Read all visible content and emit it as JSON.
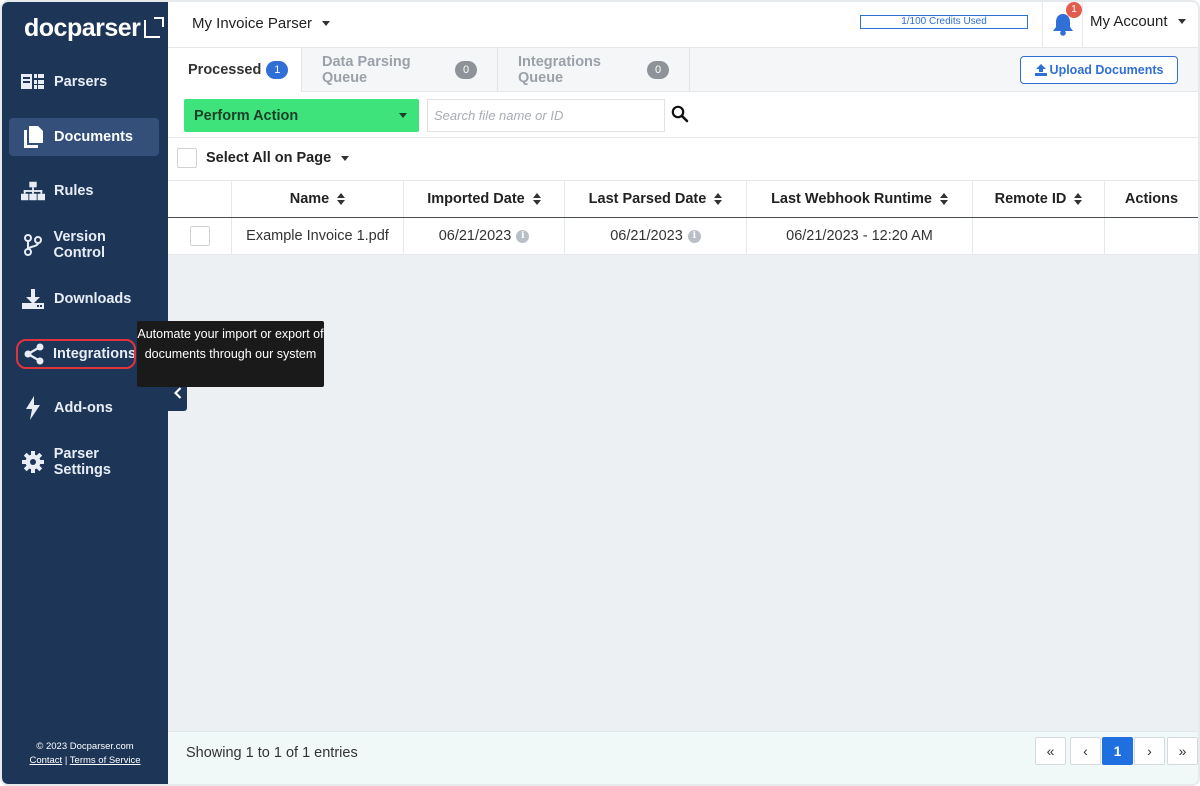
{
  "app": {
    "logo_text": "docparser"
  },
  "sidebar": {
    "items": [
      {
        "label": "Parsers",
        "icon": "parsers-icon"
      },
      {
        "label": "Documents",
        "icon": "documents-icon"
      },
      {
        "label": "Rules",
        "icon": "rules-icon"
      },
      {
        "label": "Version Control",
        "icon": "version-control-icon"
      },
      {
        "label": "Downloads",
        "icon": "downloads-icon"
      },
      {
        "label": "Integrations",
        "icon": "share-icon"
      },
      {
        "label": "Add-ons",
        "icon": "bolt-icon"
      },
      {
        "label": "Parser Settings",
        "icon": "gear-icon"
      }
    ],
    "active_item": "Documents",
    "highlighted_item": "Integrations",
    "footer": {
      "copyright": "© 2023 Docparser.com",
      "contact": "Contact",
      "separator": "|",
      "terms": "Terms of Service"
    }
  },
  "tooltip": {
    "text": "Automate your import or export of documents through our system"
  },
  "topbar": {
    "parser_name": "My Invoice Parser",
    "credits": "1/100 Credits Used",
    "notifications_count": "1",
    "account_label": "My Account"
  },
  "tabs": [
    {
      "label": "Processed",
      "count": "1",
      "active": true
    },
    {
      "label": "Data Parsing Queue",
      "count": "0",
      "active": false
    },
    {
      "label": "Integrations Queue",
      "count": "0",
      "active": false
    }
  ],
  "toolbar": {
    "upload_label": "Upload Documents",
    "perform_action_label": "Perform Action",
    "search_placeholder": "Search file name or ID",
    "select_all_label": "Select All on Page"
  },
  "table": {
    "columns": [
      "Name",
      "Imported Date",
      "Last Parsed Date",
      "Last Webhook Runtime",
      "Remote ID",
      "Actions"
    ],
    "rows": [
      {
        "name": "Example Invoice 1.pdf",
        "imported_date": "06/21/2023",
        "last_parsed_date": "06/21/2023",
        "last_webhook_runtime": "06/21/2023 - 12:20 AM",
        "remote_id": "",
        "actions": ""
      }
    ]
  },
  "pagination": {
    "summary": "Showing 1 to 1 of 1 entries",
    "first": "«",
    "prev": "‹",
    "current": "1",
    "next": "›",
    "last": "»"
  },
  "colors": {
    "sidebar_bg": "#1d3657",
    "accent_blue": "#2f6fd6",
    "perform_green": "#3ee37c",
    "highlight_red": "#e0333c"
  }
}
